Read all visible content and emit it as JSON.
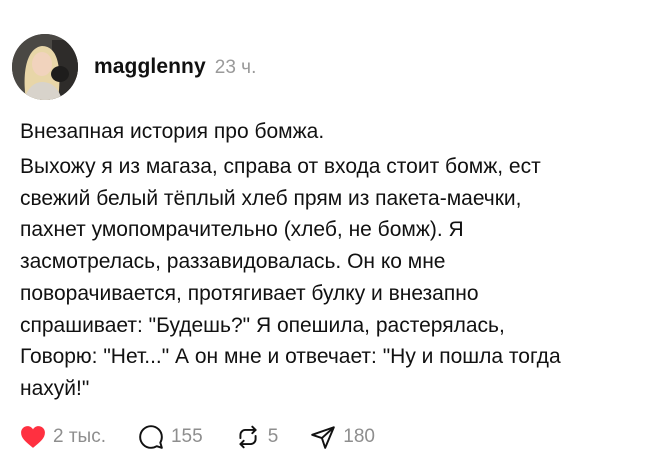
{
  "post": {
    "author": "magglenny",
    "time": "23 ч.",
    "title": "Внезапная история про бомжа.",
    "body_lines": [
      "Выхожу я из магаза, справа от входа стоит бомж, ест",
      "свежий белый тёплый хлеб прям из пакета-маечки,",
      "пахнет умопомрачительно (хлеб, не бомж). Я",
      "засмотрелась, раззавидовалась. Он ко мне",
      "поворачивается, протягивает булку и внезапно",
      "спрашивает: \"Будешь?\" Я опешила, растерялась,",
      "Говорю: \"Нет...\" А он мне и отвечает: \"Ну и пошла тогда",
      "нахуй!\""
    ]
  },
  "actions": {
    "likes": "2 тыс.",
    "comments": "155",
    "reposts": "5",
    "shares": "180"
  },
  "colors": {
    "like_red": "#ff3040",
    "muted": "#8e8e8e"
  },
  "icons": [
    "heart-icon",
    "comment-icon",
    "repost-icon",
    "share-icon"
  ]
}
